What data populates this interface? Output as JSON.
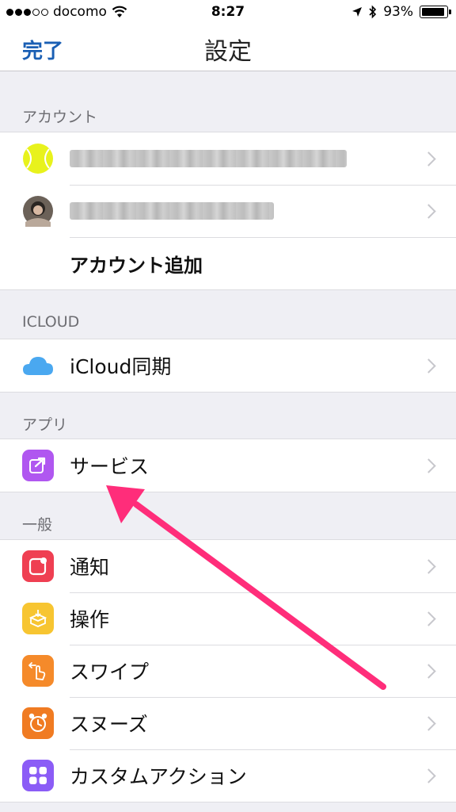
{
  "status_bar": {
    "carrier": "docomo",
    "time": "8:27",
    "battery_percent": "93%",
    "battery_level": 0.93,
    "icons": [
      "signal-dots-icon",
      "wifi-icon",
      "location-icon",
      "bluetooth-icon",
      "battery-icon"
    ]
  },
  "nav": {
    "done_label": "完了",
    "title": "設定"
  },
  "sections": {
    "account": {
      "header": "アカウント",
      "add_account_label": "アカウント追加"
    },
    "icloud": {
      "header": "ICLOUD",
      "sync_label": "iCloud同期"
    },
    "apps": {
      "header": "アプリ",
      "services_label": "サービス"
    },
    "general": {
      "header": "一般",
      "items": [
        {
          "label": "通知",
          "icon": "notification-icon",
          "color": "#ef3f52"
        },
        {
          "label": "操作",
          "icon": "action-box-icon",
          "color": "#f7c531"
        },
        {
          "label": "スワイプ",
          "icon": "swipe-hand-icon",
          "color": "#f58a2a"
        },
        {
          "label": "スヌーズ",
          "icon": "alarm-clock-icon",
          "color": "#f07b22"
        },
        {
          "label": "カスタムアクション",
          "icon": "grid-icon",
          "color": "#8b5cf6"
        }
      ]
    }
  },
  "colors": {
    "accent": "#1a5fb4",
    "annotation_arrow": "#ff2d7a",
    "services_icon": "#b057f0",
    "icloud_icon": "#4aa8f0"
  }
}
